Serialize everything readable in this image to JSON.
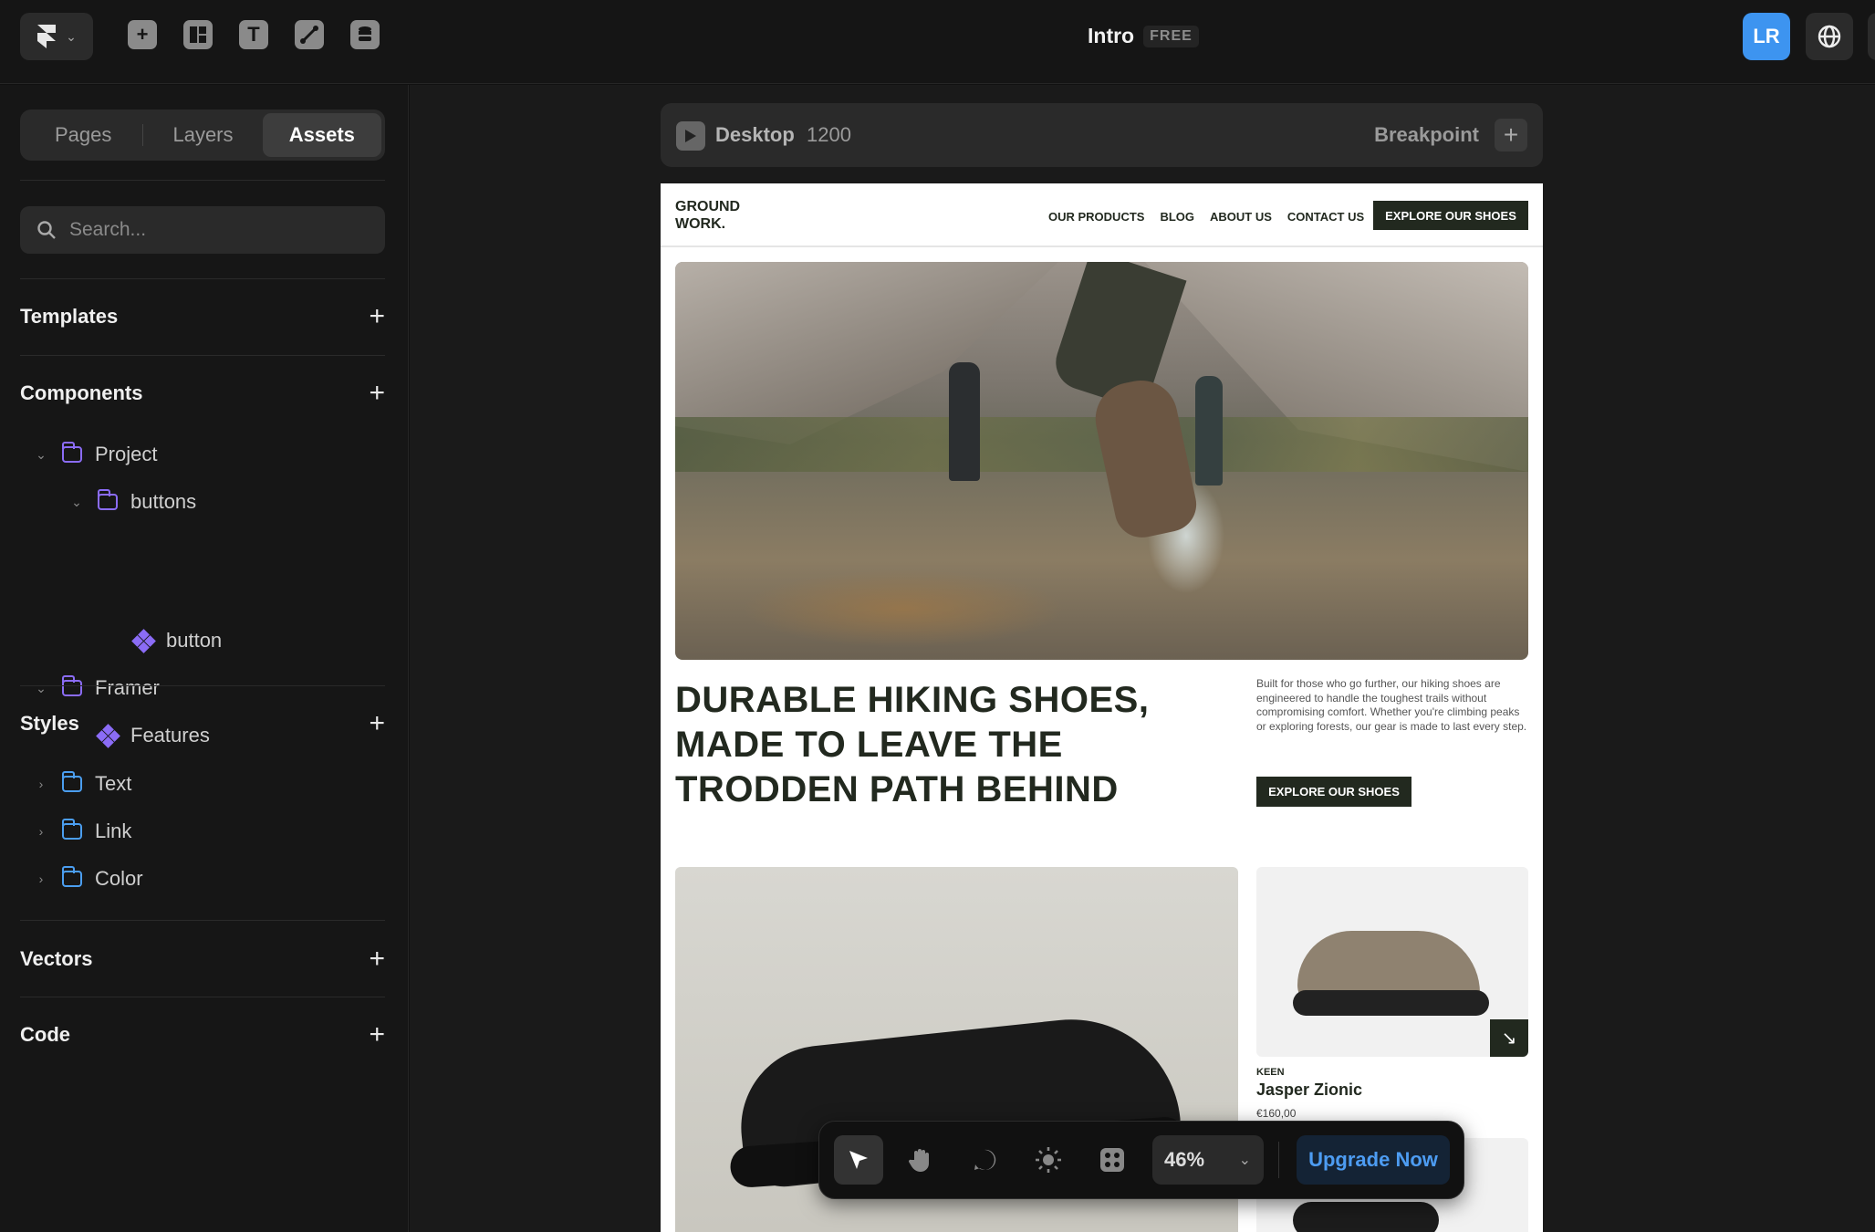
{
  "topbar": {
    "title": "Intro",
    "badge": "FREE",
    "avatar_initials": "LR",
    "tools": [
      "insert-icon",
      "layout-icon",
      "text-icon",
      "vector-pen-icon",
      "cms-icon"
    ]
  },
  "sidebar": {
    "tabs": [
      {
        "label": "Pages",
        "active": false
      },
      {
        "label": "Layers",
        "active": false
      },
      {
        "label": "Assets",
        "active": true
      }
    ],
    "search": {
      "placeholder": "Search..."
    },
    "sections": {
      "templates": "Templates",
      "components": "Components",
      "styles": "Styles",
      "vectors": "Vectors",
      "code": "Code"
    },
    "components_tree": [
      {
        "label": "Project",
        "type": "folder"
      },
      {
        "label": "buttons",
        "type": "folder"
      },
      {
        "label": "button",
        "type": "component"
      },
      {
        "label": "Framer",
        "type": "folder"
      },
      {
        "label": "Features",
        "type": "component"
      }
    ],
    "styles_tree": [
      {
        "label": "Text"
      },
      {
        "label": "Link"
      },
      {
        "label": "Color"
      }
    ]
  },
  "breakpoint_bar": {
    "name": "Desktop",
    "width": "1200",
    "breakpoint_label": "Breakpoint"
  },
  "site": {
    "brand": "GROUND WORK.",
    "nav": [
      "OUR PRODUCTS",
      "BLOG",
      "ABOUT US",
      "CONTACT US"
    ],
    "nav_cta": "EXPLORE OUR SHOES",
    "headline": "DURABLE HIKING SHOES, MADE TO LEAVE THE TRODDEN PATH BEHIND",
    "intro": "Built for those who go further, our hiking shoes are engineered to handle the toughest trails without compromising comfort. Whether you're climbing peaks or exploring forests, our gear is made to last every step.",
    "intro_cta": "EXPLORE OUR SHOES",
    "product": {
      "brand": "KEEN",
      "name": "Jasper Zionic",
      "price": "€160,00"
    }
  },
  "float_toolbar": {
    "zoom": "46%",
    "upgrade": "Upgrade Now"
  },
  "colors": {
    "accent": "#3d94f0",
    "component": "#8b6cf6",
    "style_folder": "#4b9ef0",
    "site_dark": "#22291f"
  }
}
